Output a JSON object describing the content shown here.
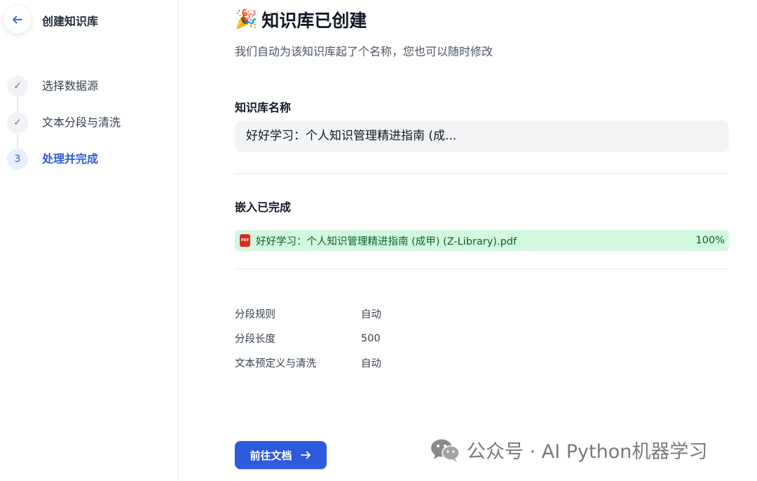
{
  "sidebar": {
    "title": "创建知识库",
    "steps": [
      {
        "marker": "✓",
        "label": "选择数据源",
        "state": "done"
      },
      {
        "marker": "✓",
        "label": "文本分段与清洗",
        "state": "done"
      },
      {
        "marker": "3",
        "label": "处理并完成",
        "state": "active"
      }
    ]
  },
  "main": {
    "title_emoji": "🎉",
    "title": "知识库已创建",
    "subtitle": "我们自动为该知识库起了个名称，您也可以随时修改",
    "name_label": "知识库名称",
    "name_value": "好好学习：个人知识管理精进指南 (成...",
    "embed_label": "嵌入已完成",
    "file": {
      "icon_text": "PDF",
      "name": "好好学习：个人知识管理精进指南 (成甲) (Z-Library).pdf",
      "percent": "100%"
    },
    "settings": [
      {
        "key": "分段规则",
        "value": "自动"
      },
      {
        "key": "分段长度",
        "value": "500"
      },
      {
        "key": "文本预定义与清洗",
        "value": "自动"
      }
    ],
    "go_button": "前往文档"
  },
  "watermark": "公众号 · AI Python机器学习",
  "colors": {
    "accent": "#2e5bdd",
    "success_bg": "#d3f8df",
    "success_text": "#085d3a",
    "pdf_red": "#d92d20"
  }
}
